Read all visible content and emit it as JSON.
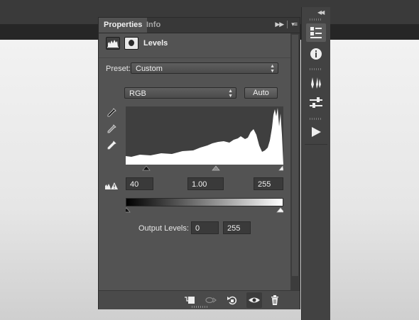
{
  "panel": {
    "tabs": [
      {
        "label": "Properties",
        "active": true
      },
      {
        "label": "Info",
        "active": false
      }
    ],
    "title": "Levels",
    "preset": {
      "label": "Preset:",
      "value": "Custom"
    },
    "channel": {
      "value": "RGB"
    },
    "auto_label": "Auto",
    "input_levels": {
      "black": "40",
      "gamma": "1.00",
      "white": "255"
    },
    "output_levels": {
      "label": "Output Levels:",
      "black": "0",
      "white": "255"
    }
  },
  "footer_icons": [
    "clip-to-layer-icon",
    "view-previous-icon",
    "reset-icon",
    "visibility-eye-icon",
    "trash-icon"
  ],
  "dock_icons": [
    "properties-icon",
    "info-icon",
    "brushes-icon",
    "adjustments-icon",
    "play-actions-icon"
  ],
  "colors": {
    "panel_bg": "#535353",
    "tab_bg": "#383838",
    "field_bg": "#3a3a3a",
    "histogram_fill": "#ffffff"
  }
}
